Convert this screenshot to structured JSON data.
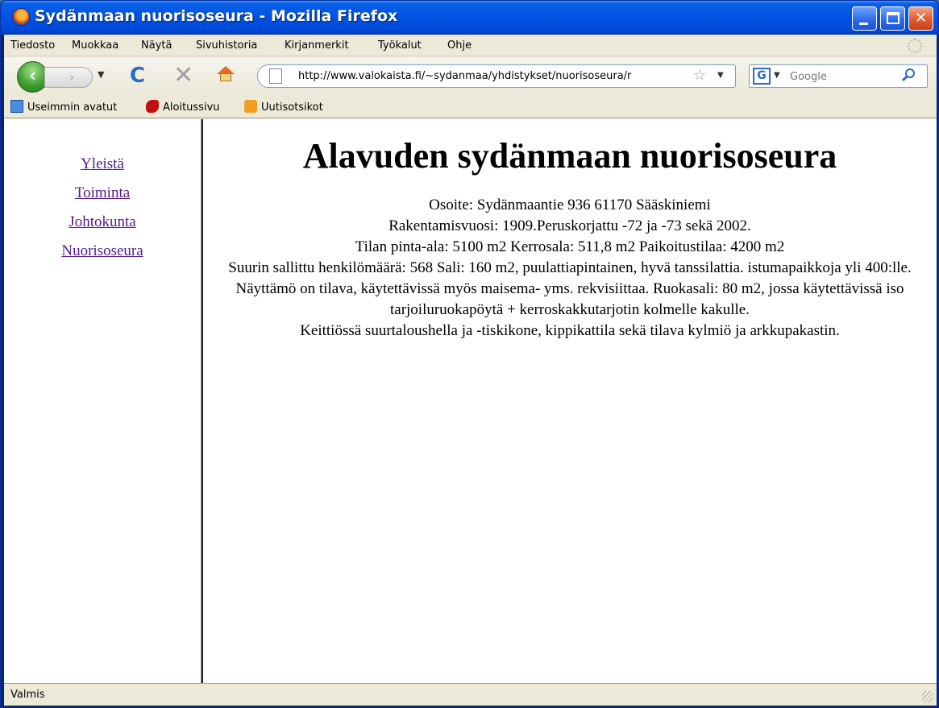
{
  "window": {
    "title": "Sydänmaan nuorisoseura - Mozilla Firefox"
  },
  "menubar": {
    "items": [
      "Tiedosto",
      "Muokkaa",
      "Näytä",
      "Sivuhistoria",
      "Kirjanmerkit",
      "Työkalut",
      "Ohje"
    ]
  },
  "navbar": {
    "url": "http://www.valokaista.fi/~sydanmaa/yhdistykset/nuorisoseura/r",
    "search_placeholder": "Google",
    "search_engine_icon": "G"
  },
  "bookmarks": {
    "items": [
      "Useimmin avatut",
      "Aloitussivu",
      "Uutisotsikot"
    ]
  },
  "sidebar": {
    "links": [
      "Yleistä",
      "Toiminta",
      "Johtokunta",
      "Nuorisoseura"
    ]
  },
  "main": {
    "title": "Alavuden sydänmaan nuorisoseura",
    "lines": [
      "Osoite: Sydänmaantie 936 61170 Sääskiniemi",
      "Rakentamisvuosi: 1909.Peruskorjattu -72 ja -73 sekä 2002.",
      "Tilan pinta-ala: 5100 m2 Kerrosala: 511,8 m2 Paikoitustilaa: 4200 m2",
      "Suurin sallittu henkilömäärä: 568 Sali: 160 m2, puulattiapintainen, hyvä tanssilattia. istumapaikkoja yli 400:lle. Näyttämö on tilava, käytettävissä myös maisema- yms. rekvisiittaa. Ruokasali: 80 m2, jossa käytettävissä iso tarjoiluruokapöytä + kerroskakkutarjotin kolmelle kakulle.",
      "Keittiössä suurtaloushella ja -tiskikone, kippikattila sekä tilava kylmiö ja arkkupakastin."
    ]
  },
  "status": {
    "text": "Valmis"
  }
}
